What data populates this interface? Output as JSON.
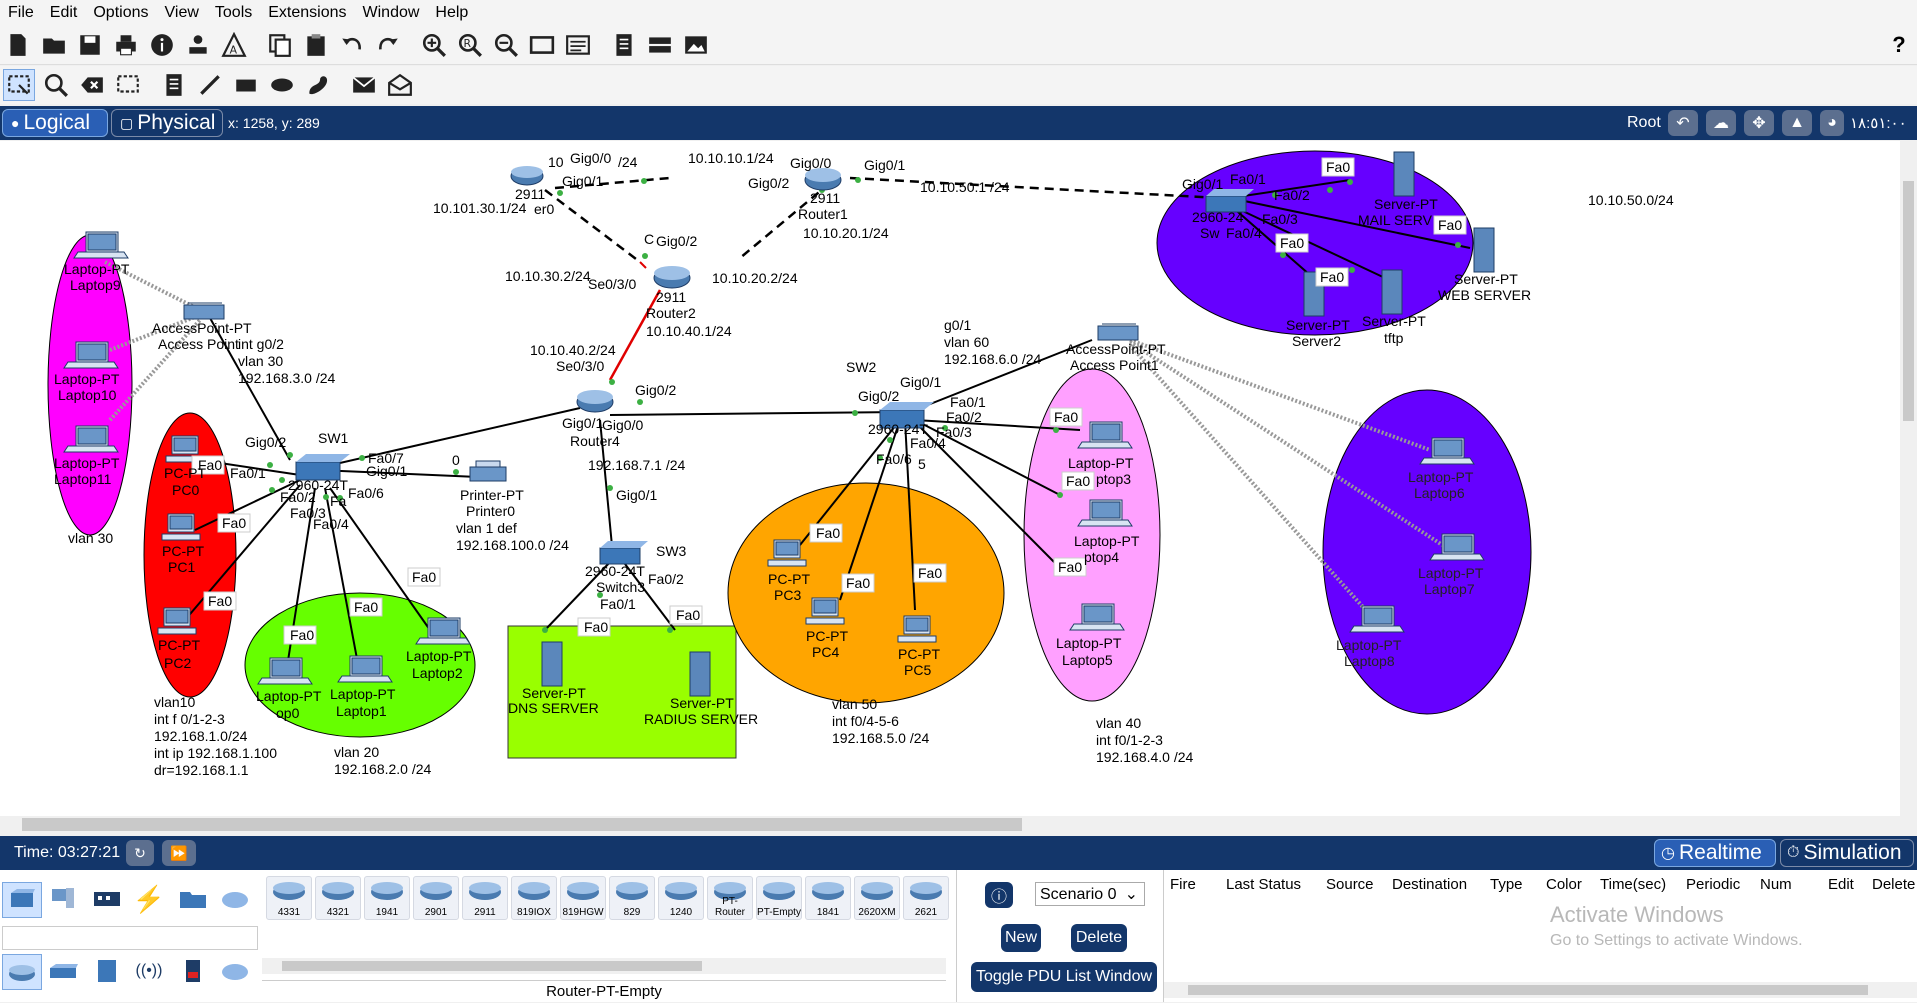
{
  "menu": [
    "File",
    "Edit",
    "Options",
    "View",
    "Tools",
    "Extensions",
    "Window",
    "Help"
  ],
  "nav": {
    "logical_label": "Logical",
    "physical_label": "Physical",
    "coords": "x: 1258, y: 289",
    "root_label": "Root",
    "clock": "١٨:٥١:٠٠"
  },
  "diagram": {
    "colors": {
      "magenta": "#ff00ff",
      "red": "#ff0000",
      "green": "#66ff00",
      "lime": "#99ff00",
      "orange": "#ffa500",
      "pink": "#ffa0ff",
      "purple": "#6600ff"
    },
    "devices": {
      "router0_model": "2911",
      "router0_name": "er0",
      "router1_model": "2911",
      "router1_name": "Router1",
      "router2_model": "2911",
      "router2_name": "Router2",
      "router4_name": "Router4",
      "sw1_name": "SW1",
      "sw1_model": "2960-24T",
      "sw2_name": "SW2",
      "sw2_model": "2960-24T",
      "sw3_name": "SW3",
      "sw3_model": "2960-24T",
      "sw3_sub": "Switch3",
      "sw4_model": "2960-24",
      "sw4_sub": "Sw",
      "ap0_type": "AccessPoint-PT",
      "ap0_name": "Access Point",
      "ap1_type": "AccessPoint-PT",
      "ap1_name": "Access Point1",
      "printer_type": "Printer-PT",
      "printer_name": "Printer0",
      "pc_type": "PC-PT",
      "laptop_type": "Laptop-PT",
      "server_type": "Server-PT",
      "pc0": "PC0",
      "pc1": "PC1",
      "pc2": "PC2",
      "pc3": "PC3",
      "pc4": "PC4",
      "pc5": "PC5",
      "laptop0": "op0",
      "laptop1": "Laptop1",
      "laptop2": "Laptop2",
      "laptop3": "ptop3",
      "laptop4": "ptop4",
      "laptop5": "Laptop5",
      "laptop6": "Laptop6",
      "laptop7": "Laptop7",
      "laptop8": "Laptop8",
      "laptop9": "Laptop9",
      "laptop10": "Laptop10",
      "laptop11": "Laptop11",
      "dns": "DNS SERVER",
      "radius": "RADIUS SERVER",
      "mail": "MAIL SERV",
      "web": "WEB SERVER",
      "server2": "Server2",
      "tftp": "tftp"
    },
    "ports": {
      "r0_g00": "Gig0/0",
      "r0_g01": "Gig0/1",
      "r0_ip": "10",
      "r1_g00": "Gig0/0",
      "r1_g01": "Gig0/1",
      "r1_g02": "Gig0/2",
      "r2_g02": "Gig0/2",
      "r2_c": "C",
      "r2_se030": "Se0/3/0",
      "r4_se030": "Se0/3/0",
      "r4_g02": "Gig0/2",
      "r4_g01": "Gig0/1",
      "r4_g00": "Gig0/0",
      "sw1_g02": "Gig0/2",
      "sw1_fa01": "Fa0/1",
      "sw1_fa02": "Fa0/2",
      "sw1_fa03": "Fa0/3",
      "sw1_fa04": "Fa0/4",
      "sw1_fa06": "Fa0/6",
      "sw1_fa07": "Fa0/7",
      "sw1_g01": "Gig0/1",
      "sw1_fa": "Fa",
      "sw2_g01": "Gig0/1",
      "sw2_g02": "Gig0/2",
      "sw2_fa01": "Fa0/1",
      "sw2_fa02": "Fa0/2",
      "sw2_fa03": "Fa0/3",
      "sw2_fa04": "Fa0/4",
      "sw2_fa06": "Fa0/6",
      "sw2_5": "5",
      "sw3_g01": "Gig0/1",
      "sw3_fa01": "Fa0/1",
      "sw3_fa02": "Fa0/2",
      "sw4_g01": "Gig0/1",
      "sw4_fa01": "Fa0/1",
      "sw4_fa02": "Fa0/2",
      "sw4_fa03": "Fa0/3",
      "sw4_fa04": "Fa0/4",
      "fa0": "Fa0",
      "printer_0": "0"
    },
    "notes": {
      "r0_g00_ip": "/24",
      "r1_g02_ip": "10.10.10.1/24",
      "r1_g01_ip": "10.10.50.1 /24",
      "r0_ip_2": "10.101.30.1/24",
      "r1_ip_2": "10.10.20.1/24",
      "r2_ip_30": "10.10.30.2/24",
      "r2_ip_20": "10.10.20.2/24",
      "r2_ip_40": "10.10.40.1/24",
      "r4_ip_40": "10.10.40.2/24",
      "r4_ip_7": "192.168.7.1 /24",
      "net_50": "10.10.50.0/24",
      "v30_1": "int g0/2",
      "v30_2": "vlan 30",
      "v30_3": "192.168.3.0 /24",
      "v60_1": "g0/1",
      "v60_2": "vlan 60",
      "v60_3": "192.168.6.0 /24",
      "vlan30_tag": "vlan 30",
      "v1_1": "vlan 1 def",
      "v1_2": "192.168.100.0 /24",
      "v10_1": "vlan10",
      "v10_2": "int f 0/1-2-3",
      "v10_3": "192.168.1.0/24",
      "v10_4": "int ip 192.168.1.100",
      "v10_5": "dr=192.168.1.1",
      "v20_1": "vlan 20",
      "v20_2": "192.168.2.0 /24",
      "v50_1": "vlan 50",
      "v50_2": "int f0/4-5-6",
      "v50_3": "192.168.5.0 /24",
      "v40_1": "vlan 40",
      "v40_2": "int f0/1-2-3",
      "v40_3": "192.168.4.0 /24"
    }
  },
  "timebar": {
    "time": "Time: 03:27:21",
    "realtime": "Realtime",
    "simulation": "Simulation"
  },
  "devices_panel": {
    "tiles": [
      "4331",
      "4321",
      "1941",
      "2901",
      "2911",
      "819IOX",
      "819HGW",
      "829",
      "1240",
      "PT-Router",
      "PT-Empty",
      "1841",
      "2620XM",
      "2621"
    ],
    "selected_device": "Router-PT-Empty"
  },
  "pdu": {
    "scenario": "Scenario 0",
    "new_label": "New",
    "delete_label": "Delete",
    "toggle_label": "Toggle PDU List Window",
    "columns": [
      "Fire",
      "Last Status",
      "Source",
      "Destination",
      "Type",
      "Color",
      "Time(sec)",
      "Periodic",
      "Num",
      "Edit",
      "Delete"
    ]
  },
  "watermark": {
    "line1": "Activate Windows",
    "line2": "Go to Settings to activate Windows."
  }
}
